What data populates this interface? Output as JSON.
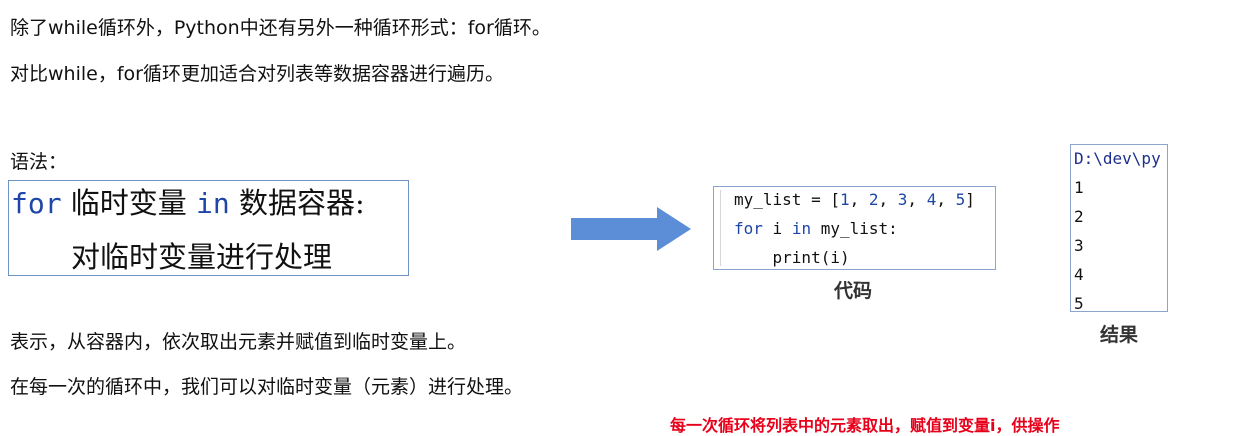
{
  "intro": {
    "line1": "除了while循环外，Python中还有另外一种循环形式：for循环。",
    "line2": "对比while，for循环更加适合对列表等数据容器进行遍历。"
  },
  "syntax": {
    "label": "语法：",
    "row1": {
      "kw_for": "for",
      "var": " 临时变量 ",
      "kw_in": "in",
      "container": " 数据容器:"
    },
    "row2": "对临时变量进行处理"
  },
  "arrow": {
    "color": "#5b8ed6",
    "icon": "right-arrow-icon"
  },
  "code": {
    "line1_prefix": "my_list = [",
    "line1_nums": [
      "1",
      "2",
      "3",
      "4",
      "5"
    ],
    "line1_suffix": "]",
    "line2_kw_for": "for",
    "line2_mid": " i ",
    "line2_kw_in": "in",
    "line2_rest": " my_list:",
    "line3": "    print(i)",
    "caption": "代码"
  },
  "result": {
    "path": "D:\\dev\\py",
    "values": [
      "1",
      "2",
      "3",
      "4",
      "5"
    ],
    "caption": "结果"
  },
  "explain": {
    "line1": "表示，从容器内，依次取出元素并赋值到临时变量上。",
    "line2": "在每一次的循环中，我们可以对临时变量（元素）进行处理。"
  },
  "note": "每一次循环将列表中的元素取出，赋值到变量i，供操作",
  "colors": {
    "keyword": "#1e46a8",
    "note": "#e8001b",
    "box_border": "#6f93c7"
  }
}
